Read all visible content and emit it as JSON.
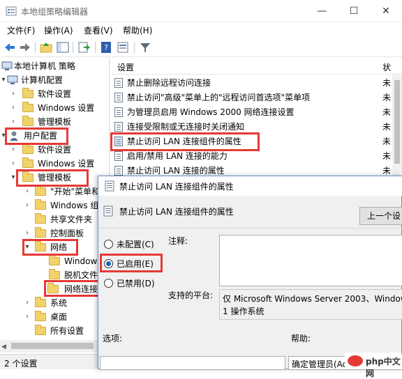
{
  "window": {
    "title": "本地组策略编辑器",
    "minimize": "—",
    "maximize": "☐",
    "close": "✕"
  },
  "menu": [
    "文件(F)",
    "操作(A)",
    "查看(V)",
    "帮助(H)"
  ],
  "tree": {
    "root": "本地计算机 策略",
    "computer_config": "计算机配置",
    "software_settings_1": "软件设置",
    "windows_settings_1": "Windows 设置",
    "admin_templates_1": "管理模板",
    "user_config": "用户配置",
    "software_settings_2": "软件设置",
    "windows_settings_2": "Windows 设置",
    "admin_templates_2": "管理模板",
    "start_menu": "\"开始\"菜单和",
    "windows_components": "Windows 组",
    "shared_folders": "共享文件夹",
    "control_panel": "控制面板",
    "network": "网络",
    "windows_sub": "Window",
    "offline_files": "脱机文件",
    "network_conn": "网络连接",
    "system": "系统",
    "desktop": "桌面",
    "all_settings": "所有设置"
  },
  "list": {
    "header": "设置",
    "state_header": "状",
    "rows": [
      {
        "name": "禁止删除远程访问连接",
        "state": "未"
      },
      {
        "name": "禁止访问\"高级\"菜单上的\"远程访问首选项\"菜单项",
        "state": "未"
      },
      {
        "name": "为管理员启用 Windows 2000 网络连接设置",
        "state": "未"
      },
      {
        "name": "连接受限制或无连接时关闭通知",
        "state": "未"
      },
      {
        "name": "禁止访问 LAN 连接组件的属性",
        "state": "未"
      },
      {
        "name": "启用/禁用 LAN 连接的能力",
        "state": "未"
      },
      {
        "name": "禁止访问 LAN 连接的属性",
        "state": "未"
      }
    ]
  },
  "status": "2 个设置",
  "dialog": {
    "title": "禁止访问 LAN 连接组件的属性",
    "heading": "禁止访问 LAN 连接组件的属性",
    "prev_button": "上一个设",
    "radio_not_configured": "未配置(C)",
    "radio_enabled": "已启用(E)",
    "radio_disabled": "已禁用(D)",
    "comment_label": "注释:",
    "supported_label": "支持的平台:",
    "supported_text_1": "仅 Microsoft Windows Server 2003、Window",
    "supported_text_2": "1 操作系统",
    "options_label": "选项:",
    "help_label": "帮助:",
    "help_text": "确定管理员(Ad"
  },
  "watermark": "php中文网"
}
